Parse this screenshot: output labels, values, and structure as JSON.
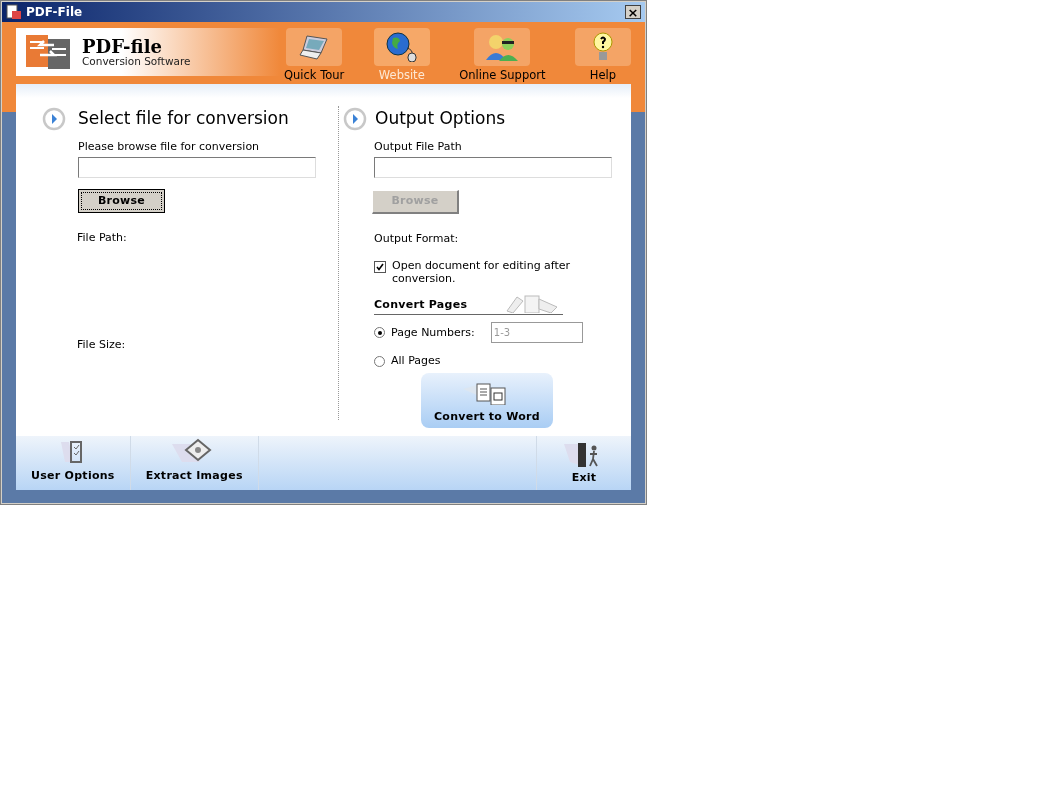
{
  "window": {
    "title": "PDF-File",
    "close": "×"
  },
  "logo": {
    "name": "PDF-file",
    "tagline": "Conversion Software"
  },
  "nav": [
    {
      "label": "Quick Tour",
      "kind": "laptop",
      "selected": false
    },
    {
      "label": "Website",
      "kind": "globe",
      "selected": true
    },
    {
      "label": "Online Support",
      "kind": "people",
      "selected": false
    },
    {
      "label": "Help",
      "kind": "bulb",
      "selected": false
    }
  ],
  "input_section": {
    "title": "Select file for conversion",
    "field_label": "Please browse file for conversion",
    "browse": {
      "label": "Browse",
      "disabled": false
    },
    "file_path_label": "File Path:",
    "file_size_label": "File Size:"
  },
  "output_section": {
    "title": "Output Options",
    "field_label": "Output File Path",
    "browse": {
      "label": "Browse",
      "disabled": true
    },
    "format_label": "Output Format:",
    "open_after": {
      "label": "Open document for editing after conversion.",
      "checked": true
    },
    "convert_pages_title": "Convert Pages",
    "page_options": [
      {
        "label": "Page Numbers:",
        "selected": true,
        "value": "1-3"
      },
      {
        "label": "All Pages",
        "selected": false
      }
    ],
    "convert_button": "Convert to Word"
  },
  "toolbar": [
    {
      "label": "User Options",
      "kind": "checklist"
    },
    {
      "label": "Extract Images",
      "kind": "images"
    }
  ],
  "exit_button": "Exit"
}
